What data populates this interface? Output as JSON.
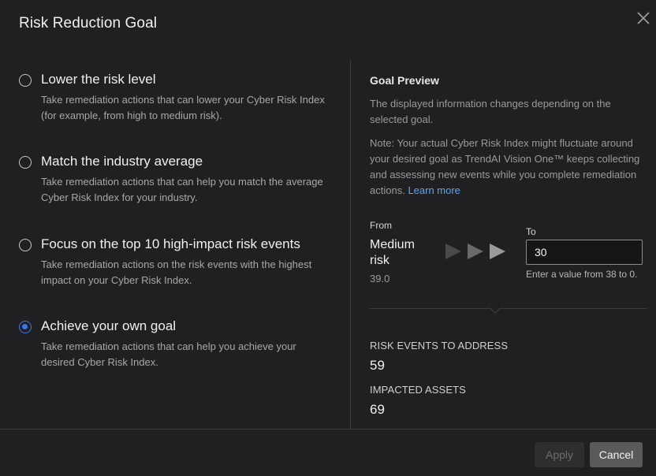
{
  "dialog": {
    "title": "Risk Reduction Goal",
    "close_icon": "close-icon"
  },
  "options": [
    {
      "label": "Lower the risk level",
      "description": "Take remediation actions that can lower your Cyber Risk Index (for example, from high to medium risk).",
      "checked": false
    },
    {
      "label": "Match the industry average",
      "description": "Take remediation actions that can help you match the average Cyber Risk Index for your industry.",
      "checked": false
    },
    {
      "label": "Focus on the top 10 high-impact risk events",
      "description": "Take remediation actions on the risk events with the highest impact on your Cyber Risk Index.",
      "checked": false
    },
    {
      "label": "Achieve your own goal",
      "description": "Take remediation actions that can help you achieve your desired Cyber Risk Index.",
      "checked": true
    }
  ],
  "preview": {
    "title": "Goal Preview",
    "description": "The displayed information changes depending on the selected goal.",
    "note": "Note: Your actual Cyber Risk Index might fluctuate around your desired goal as TrendAI Vision One™ keeps collecting and assessing new events while you complete remediation actions.",
    "learn_more": "Learn more",
    "from_label": "From",
    "from_level": "Medium risk",
    "from_value": "39.0",
    "to_label": "To",
    "to_value": "30",
    "to_hint": "Enter a value from 38 to 0.",
    "stats": [
      {
        "label": "RISK EVENTS TO ADDRESS",
        "value": "59"
      },
      {
        "label": "IMPACTED ASSETS",
        "value": "69"
      }
    ]
  },
  "footer": {
    "apply_label": "Apply",
    "cancel_label": "Cancel"
  },
  "colors": {
    "background": "#202022",
    "accent": "#3a78e7",
    "link": "#5ea3f3"
  }
}
